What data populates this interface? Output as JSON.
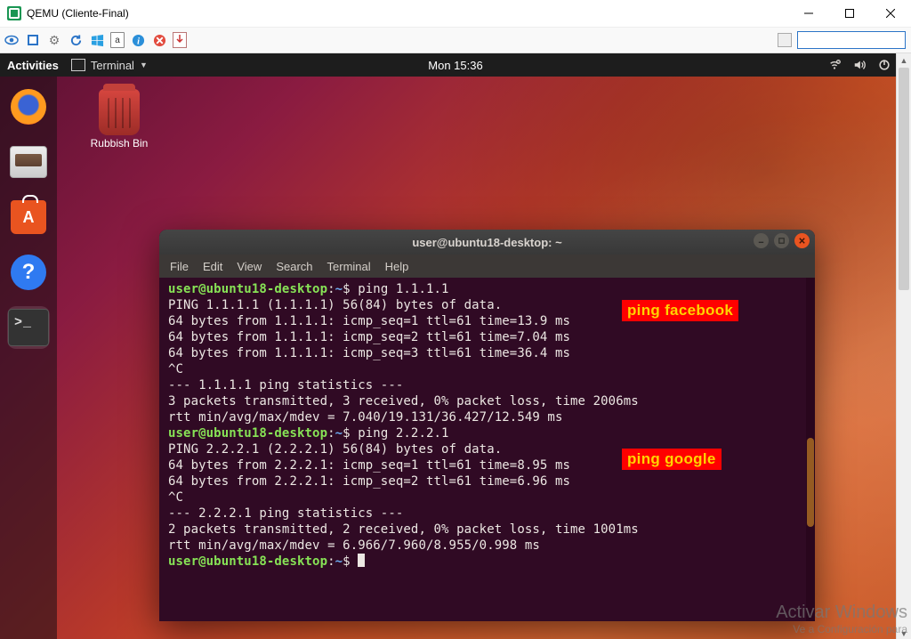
{
  "window": {
    "title": "QEMU (Cliente-Final)"
  },
  "qemu_toolbar": {
    "icons": [
      "eye-icon",
      "fullscreen-icon",
      "gear-icon",
      "refresh-icon",
      "windows-icon",
      "key-a-icon",
      "info-icon",
      "stop-icon",
      "attach-icon"
    ]
  },
  "panel": {
    "activities": "Activities",
    "app": "Terminal",
    "clock": "Mon 15:36"
  },
  "dock": {
    "apps": [
      "firefox",
      "files",
      "software",
      "help",
      "terminal"
    ]
  },
  "desktop_icons": {
    "trash_label": "Rubbish Bin"
  },
  "terminal": {
    "title": "user@ubuntu18-desktop: ~",
    "menu": [
      "File",
      "Edit",
      "View",
      "Search",
      "Terminal",
      "Help"
    ],
    "prompt_user": "user@ubuntu18-desktop",
    "prompt_path": "~",
    "lines": [
      {
        "t": "prompt",
        "cmd": "ping 1.1.1.1"
      },
      {
        "t": "out",
        "txt": "PING 1.1.1.1 (1.1.1.1) 56(84) bytes of data."
      },
      {
        "t": "out",
        "txt": "64 bytes from 1.1.1.1: icmp_seq=1 ttl=61 time=13.9 ms"
      },
      {
        "t": "out",
        "txt": "64 bytes from 1.1.1.1: icmp_seq=2 ttl=61 time=7.04 ms"
      },
      {
        "t": "out",
        "txt": "64 bytes from 1.1.1.1: icmp_seq=3 ttl=61 time=36.4 ms"
      },
      {
        "t": "out",
        "txt": "^C"
      },
      {
        "t": "out",
        "txt": "--- 1.1.1.1 ping statistics ---"
      },
      {
        "t": "out",
        "txt": "3 packets transmitted, 3 received, 0% packet loss, time 2006ms"
      },
      {
        "t": "out",
        "txt": "rtt min/avg/max/mdev = 7.040/19.131/36.427/12.549 ms"
      },
      {
        "t": "prompt",
        "cmd": "ping 2.2.2.1"
      },
      {
        "t": "out",
        "txt": "PING 2.2.2.1 (2.2.2.1) 56(84) bytes of data."
      },
      {
        "t": "out",
        "txt": "64 bytes from 2.2.2.1: icmp_seq=1 ttl=61 time=8.95 ms"
      },
      {
        "t": "out",
        "txt": "64 bytes from 2.2.2.1: icmp_seq=2 ttl=61 time=6.96 ms"
      },
      {
        "t": "out",
        "txt": "^C"
      },
      {
        "t": "out",
        "txt": "--- 2.2.2.1 ping statistics ---"
      },
      {
        "t": "out",
        "txt": "2 packets transmitted, 2 received, 0% packet loss, time 1001ms"
      },
      {
        "t": "out",
        "txt": "rtt min/avg/max/mdev = 6.966/7.960/8.955/0.998 ms"
      },
      {
        "t": "prompt",
        "cmd": ""
      }
    ]
  },
  "annotations": {
    "a1": "ping facebook",
    "a2": "ping google"
  },
  "watermark": {
    "line1": "Activar Windows",
    "line2": "Ve a Configuración para"
  }
}
